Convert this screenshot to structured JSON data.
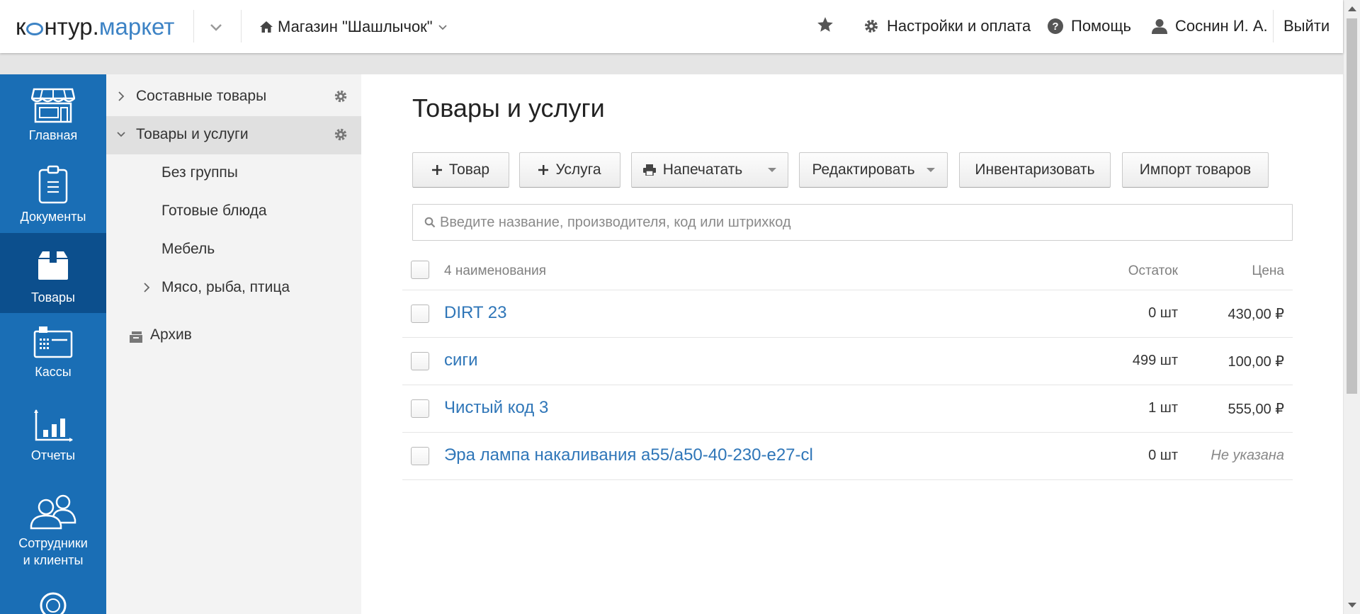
{
  "header": {
    "logo": {
      "part1": "к",
      "part2": "нтур",
      "dot": ".",
      "part3": "маркет"
    },
    "store_name": "Магазин \"Шашлычок\"",
    "settings_label": "Настройки и оплата",
    "help_label": "Помощь",
    "user_name": "Соснин И. А.",
    "logout_label": "Выйти"
  },
  "sidebar": {
    "items": [
      {
        "label": "Главная",
        "icon": "shop-icon"
      },
      {
        "label": "Документы",
        "icon": "clipboard-icon"
      },
      {
        "label": "Товары",
        "icon": "box-icon",
        "active": true
      },
      {
        "label": "Кассы",
        "icon": "cash-register-icon"
      },
      {
        "label": "Отчеты",
        "icon": "bar-chart-icon"
      },
      {
        "label_line1": "Сотрудники",
        "label_line2": "и клиенты",
        "icon": "people-icon"
      }
    ]
  },
  "categories": {
    "items": [
      {
        "label": "Составные товары",
        "expanded": false
      },
      {
        "label": "Товары и услуги",
        "expanded": true,
        "active": true
      },
      {
        "label": "Без группы"
      },
      {
        "label": "Готовые блюда"
      },
      {
        "label": "Мебель"
      },
      {
        "label": "Мясо, рыба, птица"
      },
      {
        "label": "Архив"
      }
    ]
  },
  "main": {
    "title": "Товары и услуги",
    "buttons": {
      "add_product": "Товар",
      "add_service": "Услуга",
      "print": "Напечатать",
      "edit": "Редактировать",
      "inventory": "Инвентаризовать",
      "import": "Импорт товаров"
    },
    "search": {
      "placeholder": "Введите название, производителя, код или штрихкод",
      "value": ""
    },
    "table": {
      "count_label": "4 наименования",
      "col_stock": "Остаток",
      "col_price": "Цена",
      "rows": [
        {
          "name": "DIRT 23",
          "stock": "0 шт",
          "price": "430,00 ₽"
        },
        {
          "name": "сиги",
          "stock": "499 шт",
          "price": "100,00 ₽"
        },
        {
          "name": "Чистый код 3",
          "stock": "1 шт",
          "price": "555,00 ₽"
        },
        {
          "name": "Эра лампа накаливания а55/а50-40-230-е27-cl",
          "stock": "0 шт",
          "price": "Не указана"
        }
      ]
    }
  },
  "colors": {
    "sidebar_bg": "#1a6eb5",
    "sidebar_active": "#0c4f8d",
    "link": "#2f76b8",
    "brand_accent": "#3d83c5"
  }
}
